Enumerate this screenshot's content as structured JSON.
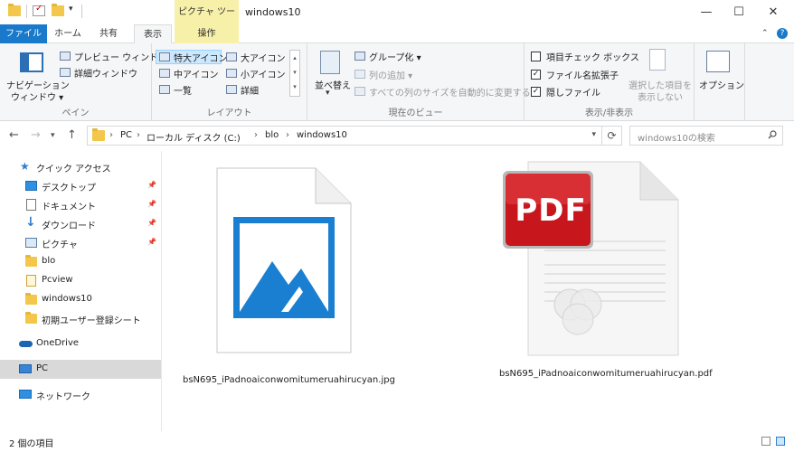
{
  "window": {
    "title": "windows10",
    "context_tab": "ピクチャ ツール",
    "minimize": "—",
    "maximize": "☐",
    "close": "✕"
  },
  "tabs": {
    "file": "ファイル",
    "home": "ホーム",
    "share": "共有",
    "view": "表示",
    "manage": "操作"
  },
  "ribbon": {
    "pane": {
      "nav_pane_line1": "ナビゲーション",
      "nav_pane_line2": "ウィンドウ ▾",
      "preview": "プレビュー ウィンドウ",
      "details": "詳細ウィンドウ",
      "label": "ペイン"
    },
    "layout": {
      "xl_icons": "特大アイコン",
      "large_icons": "大アイコン",
      "medium_icons": "中アイコン",
      "small_icons": "小アイコン",
      "list": "一覧",
      "details": "詳細",
      "label": "レイアウト"
    },
    "current_view": {
      "sort_line1": "並べ替え",
      "group_by": "グループ化 ▾",
      "add_columns": "列の追加 ▾",
      "size_columns": "すべての列のサイズを自動的に変更する",
      "label": "現在のビュー"
    },
    "show_hide": {
      "item_checkboxes": "項目チェック ボックス",
      "extensions": "ファイル名拡張子",
      "hidden_items": "隠しファイル",
      "hide_selected_line1": "選択した項目を",
      "hide_selected_line2": "表示しない",
      "label": "表示/非表示"
    },
    "options": "オプション",
    "checks": {
      "item_checkboxes": false,
      "extensions": true,
      "hidden_items": true
    }
  },
  "address": {
    "crumbs": [
      "PC",
      "ローカル ディスク (C:)",
      "blo",
      "windows10"
    ],
    "separator": "›",
    "search_placeholder": "windows10の検索"
  },
  "sidebar": {
    "items": [
      {
        "label": "クイック アクセス",
        "icon": "star-icon"
      },
      {
        "label": "デスクトップ",
        "icon": "desktop-icon",
        "pinned": true
      },
      {
        "label": "ドキュメント",
        "icon": "document-icon",
        "pinned": true
      },
      {
        "label": "ダウンロード",
        "icon": "download-icon",
        "pinned": true
      },
      {
        "label": "ピクチャ",
        "icon": "pictures-icon",
        "pinned": true
      },
      {
        "label": "blo",
        "icon": "folder-icon"
      },
      {
        "label": "Pcview",
        "icon": "folder-icon"
      },
      {
        "label": "windows10",
        "icon": "folder-icon"
      },
      {
        "label": "初期ユーザー登録シート",
        "icon": "folder-icon"
      },
      {
        "label": "OneDrive",
        "icon": "onedrive-icon"
      },
      {
        "label": "PC",
        "icon": "pc-icon",
        "selected": true
      },
      {
        "label": "ネットワーク",
        "icon": "network-icon"
      }
    ]
  },
  "files": [
    {
      "name": "bsN695_iPadnoaiconwomitumeruahirucyan.jpg",
      "type": "image-file-icon"
    },
    {
      "name": "bsN695_iPadnoaiconwomitumeruahirucyan.pdf",
      "type": "pdf-file-icon",
      "badge": "PDF"
    }
  ],
  "status": {
    "count": "2 個の項目"
  },
  "colors": {
    "accent": "#1979ca",
    "context_tab": "#f7f0a8",
    "selected": "#cce8ff",
    "pdf_red": "#c8161d"
  }
}
